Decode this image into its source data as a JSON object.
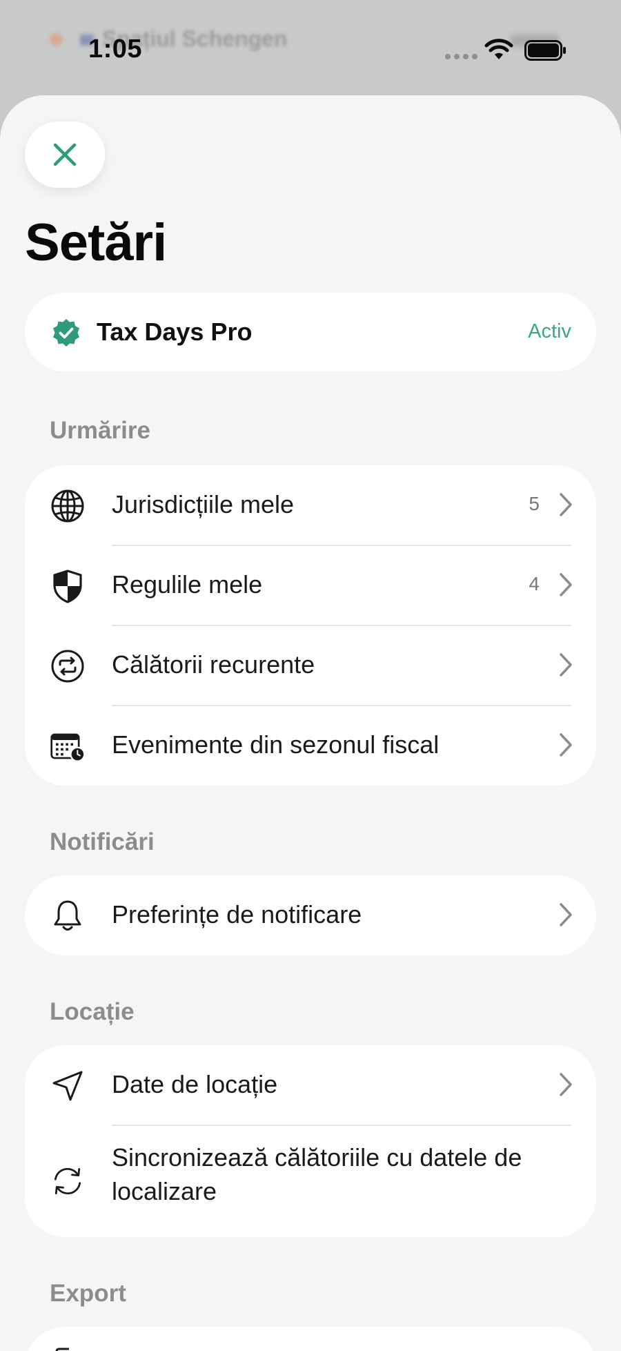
{
  "status_bar": {
    "time": "1:05",
    "background_title": "Spațiul Schengen"
  },
  "page": {
    "title": "Setări"
  },
  "pro": {
    "name": "Tax Days Pro",
    "status": "Activ"
  },
  "sections": {
    "tracking": {
      "header": "Urmărire",
      "items": [
        {
          "label": "Jurisdicțiile mele",
          "count": "5",
          "icon": "globe-icon"
        },
        {
          "label": "Regulile mele",
          "count": "4",
          "icon": "shield-icon"
        },
        {
          "label": "Călătorii recurente",
          "count": "",
          "icon": "repeat-icon"
        },
        {
          "label": "Evenimente din sezonul fiscal",
          "count": "",
          "icon": "calendar-clock-icon"
        }
      ]
    },
    "notifications": {
      "header": "Notificări",
      "items": [
        {
          "label": "Preferințe de notificare",
          "icon": "bell-icon"
        }
      ]
    },
    "location": {
      "header": "Locație",
      "items": [
        {
          "label": "Date de locație",
          "icon": "location-arrow-icon"
        },
        {
          "label": "Sincronizează călătoriile cu datele de localizare",
          "icon": "sync-icon"
        }
      ]
    },
    "export": {
      "header": "Export"
    }
  },
  "colors": {
    "accent": "#2e9c7c",
    "status_active": "#3aa882",
    "sheet_bg": "#f4f6f5",
    "card_bg": "#ffffff"
  }
}
